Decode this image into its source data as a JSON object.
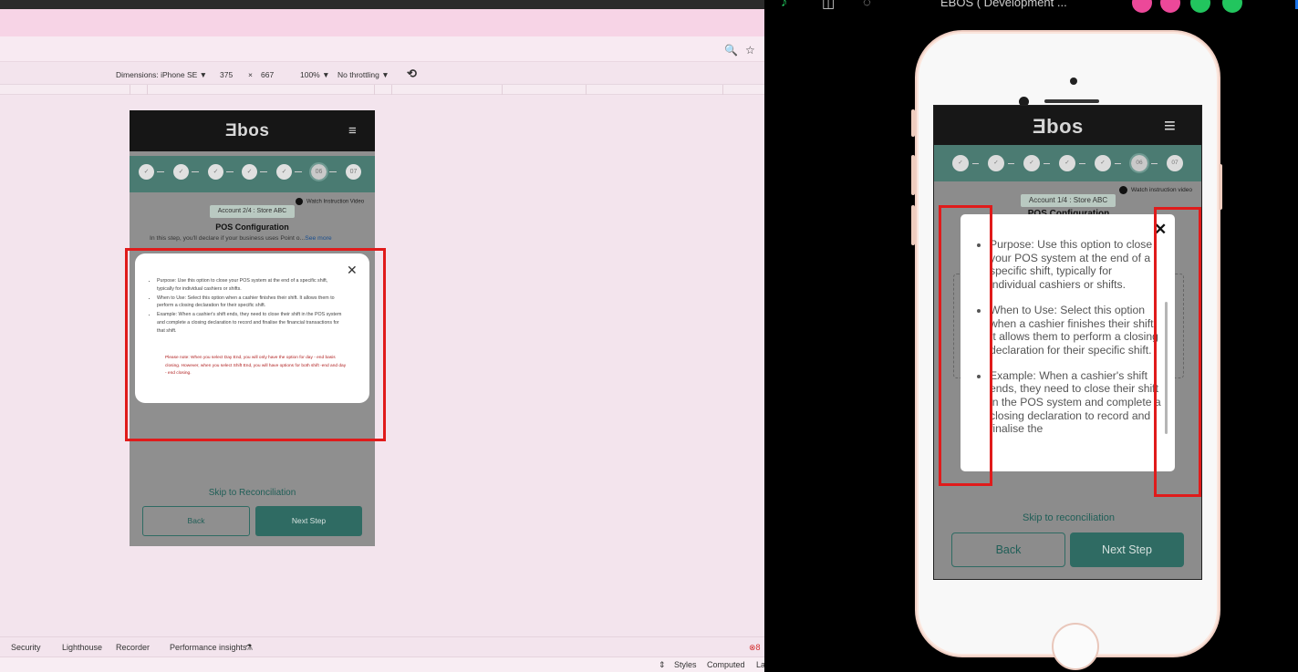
{
  "devtools": {
    "device_label": "Dimensions: iPhone SE",
    "device_caret": "▼",
    "width": "375",
    "times": "×",
    "height": "667",
    "zoom": "100%",
    "zoom_caret": "▼",
    "throttling": "No throttling",
    "throttling_caret": "▼",
    "rotate_icon": "⟲",
    "zoom_icon": "🔍",
    "star_icon": "☆",
    "bottom_tabs": [
      "Security",
      "Lighthouse",
      "Recorder",
      "Performance insights"
    ],
    "flask_icon": "⚗",
    "styles_tabs": [
      "Styles",
      "Computed",
      "La"
    ],
    "sort_icon": "⇕",
    "error_count": "8"
  },
  "mini_app": {
    "logo": "Ǝbos",
    "menu_icon": "≡",
    "steps": [
      "✓",
      "✓",
      "✓",
      "✓",
      "✓",
      "06",
      "07"
    ],
    "watch_label": "Watch Instruction Video",
    "account": "Account 2/4 : Store ABC",
    "title": "POS Configuration",
    "description": "In this step, you'll declare if your business uses Point o...",
    "see_more": "See more",
    "modal_items": [
      "Purpose: Use this option to close your POS system at the end of a specific shift, typically for individual cashiers or shifts.",
      "When to Use: Select this option when a cashier finishes their shift. It allows them to perform a closing declaration for their specific shift.",
      "Example: When a cashier's shift ends, they need to close their shift in the POS system and complete a closing declaration to record and finalise the financial transactions for that shift."
    ],
    "modal_note": "Please note: When you select Day End, you will only have the option for day - end basis closing. However, when you select Shift End, you will have options for both shift -end and day - end closing.",
    "close_icon": "✕",
    "skip": "Skip to Reconciliation",
    "back": "Back",
    "next": "Next Step"
  },
  "simulator": {
    "window_title": "EBOS ( Development ...",
    "logo": "Ǝbos",
    "menu_icon": "≡",
    "steps": [
      "✓",
      "✓",
      "✓",
      "✓",
      "✓",
      "06",
      "07"
    ],
    "watch_label": "Watch instruction video",
    "account": "Account 1/4 : Store ABC",
    "title": "POS Configuration",
    "modal_items": [
      "Purpose: Use this option to close your POS system at the end of a specific shift, typically for individual cashiers or shifts.",
      "When to Use: Select this option when a cashier finishes their shift. It allows them to perform a closing declaration for their specific shift.",
      "Example: When a cashier's shift ends, they need to close their shift in the POS system and complete a closing declaration to record and finalise the"
    ],
    "close_icon": "✕",
    "skip": "Skip to reconciliation",
    "back": "Back",
    "next": "Next Step"
  },
  "colors": {
    "highlight": "#e01b1b",
    "brand": "#2f6b63",
    "steps_bar": "#4b7b72"
  }
}
